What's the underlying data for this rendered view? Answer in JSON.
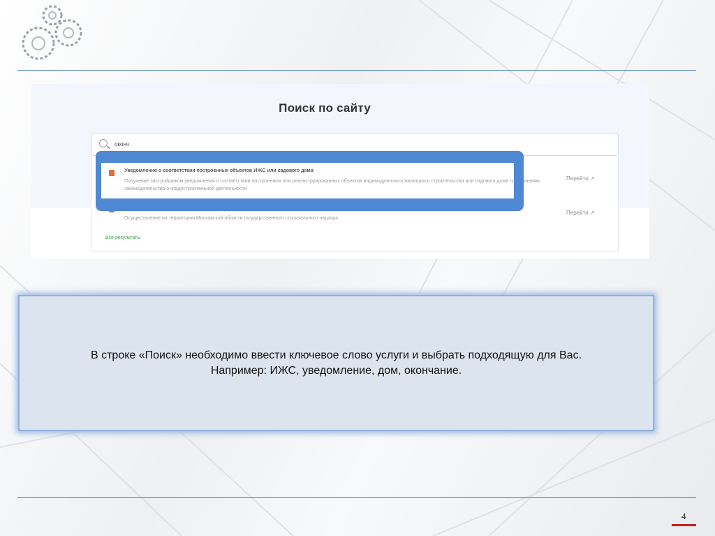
{
  "site": {
    "title": "Поиск по сайту",
    "search_value": "оконч",
    "results": [
      {
        "title": "Уведомление о соответствии построенных объектов ИЖС или садового дома",
        "description": "Получение застройщиком уведомления о соответствии построенных или реконструированных объектов индивидуального жилищного строительства или садового дома требованиям законодательства о градостроительной деятельности",
        "action": "Перейти ↗"
      },
      {
        "title": "",
        "description": "Осуществление на территории Московской области государственного строительного надзора",
        "action": "Перейти ↗"
      }
    ],
    "all_results": "Все результаты"
  },
  "note": {
    "line1": "В строке «Поиск» необходимо ввести ключевое слово услуги и выбрать подходящую для Вас.",
    "line2": "Например: ИЖС, уведомление, дом, окончание."
  },
  "page_number": "4",
  "colors": {
    "accent": "#4f88d3",
    "rule": "#4a7fc0",
    "page_mark": "#c0201e"
  }
}
